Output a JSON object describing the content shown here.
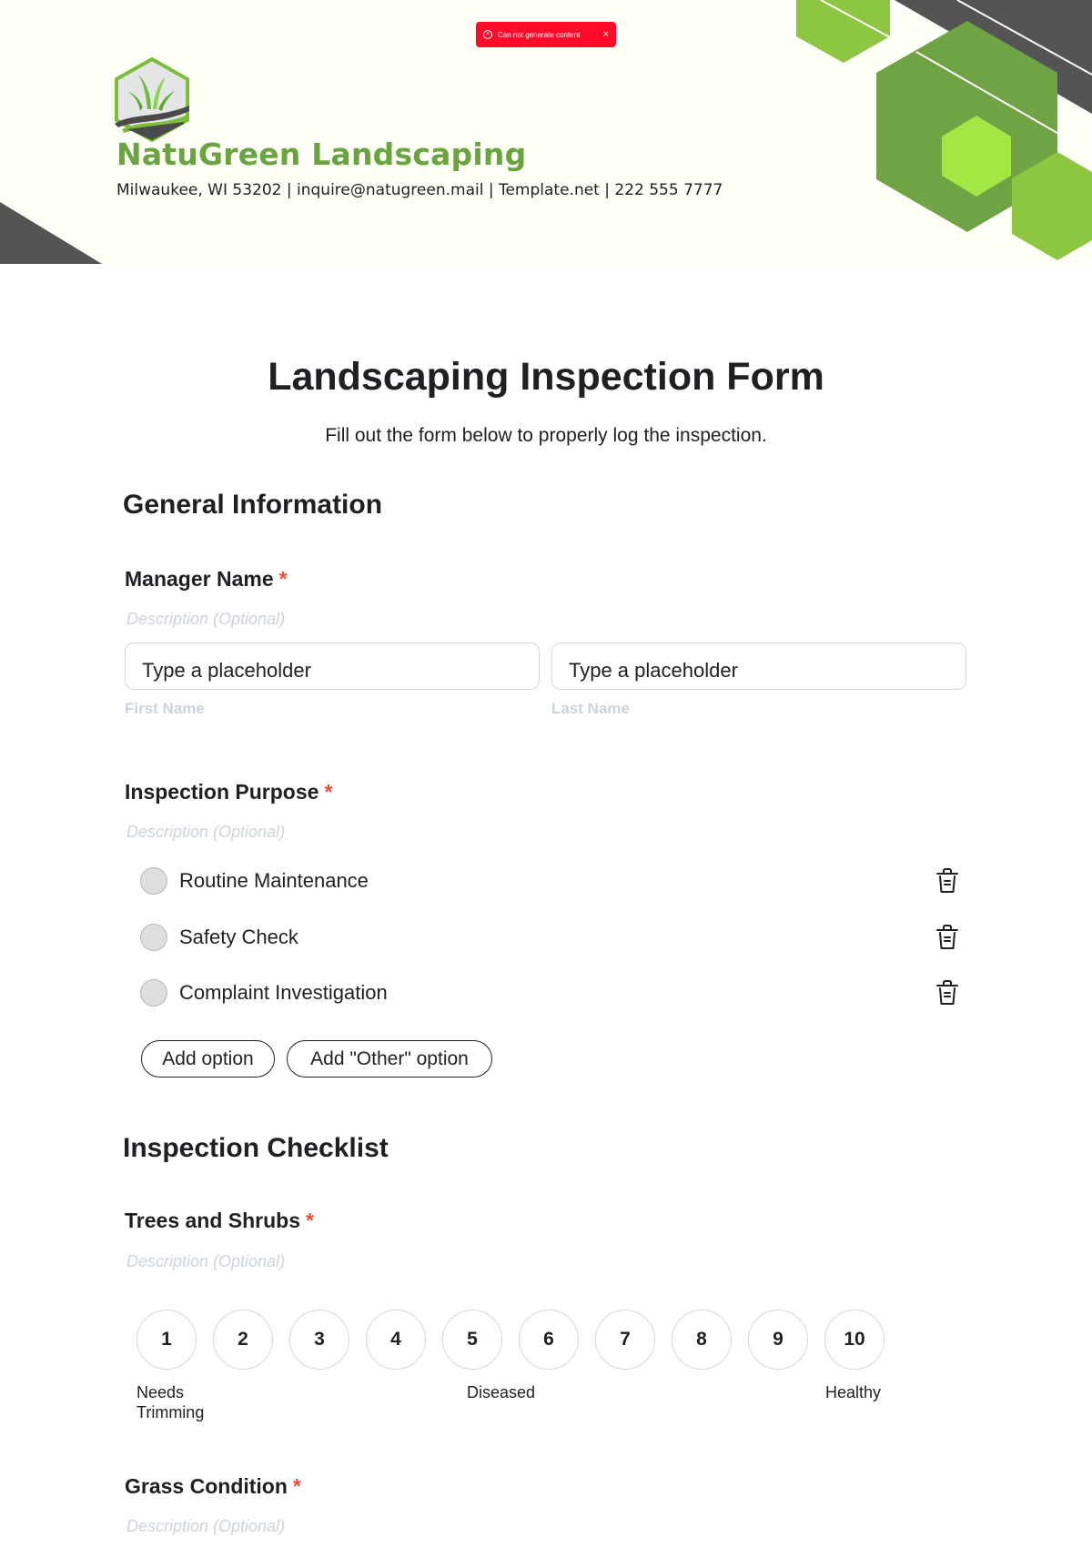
{
  "toast": {
    "message": "Can not generate content",
    "icon": "error-circle-icon",
    "close_icon": "close-icon",
    "color": "#ff0a2a"
  },
  "header": {
    "company_name": "NatuGreen Landscaping",
    "contact_line": "Milwaukee, WI 53202 | inquire@natugreen.mail | Template.net | 222 555 7777",
    "brand_color": "#6aa440",
    "logo": "grass-hexagon-logo"
  },
  "form": {
    "title": "Landscaping Inspection Form",
    "subtitle": "Fill out the form below to properly log the inspection."
  },
  "sections": {
    "general": "General Information",
    "checklist": "Inspection Checklist"
  },
  "manager_name": {
    "label": "Manager Name",
    "required_mark": "*",
    "description": "Description (Optional)",
    "first_placeholder": "Type a placeholder",
    "last_placeholder": "Type a placeholder",
    "first_label": "First Name",
    "last_label": "Last Name"
  },
  "inspection_purpose": {
    "label": "Inspection Purpose",
    "required_mark": "*",
    "description": "Description (Optional)",
    "options": [
      {
        "label": "Routine Maintenance",
        "selected": false
      },
      {
        "label": "Safety Check",
        "selected": false
      },
      {
        "label": "Complaint Investigation",
        "selected": false
      }
    ],
    "add_option": "Add option",
    "add_other_option": "Add \"Other\" option"
  },
  "trees_and_shrubs": {
    "label": "Trees and Shrubs",
    "required_mark": "*",
    "description": "Description (Optional)",
    "scale": [
      "1",
      "2",
      "3",
      "4",
      "5",
      "6",
      "7",
      "8",
      "9",
      "10"
    ],
    "low_label": "Needs Trimming",
    "low_label_line1": "Needs",
    "low_label_line2": "Trimming",
    "mid_label": "Diseased",
    "high_label": "Healthy"
  },
  "grass_condition": {
    "label": "Grass Condition",
    "required_mark": "*",
    "description": "Description (Optional)"
  }
}
